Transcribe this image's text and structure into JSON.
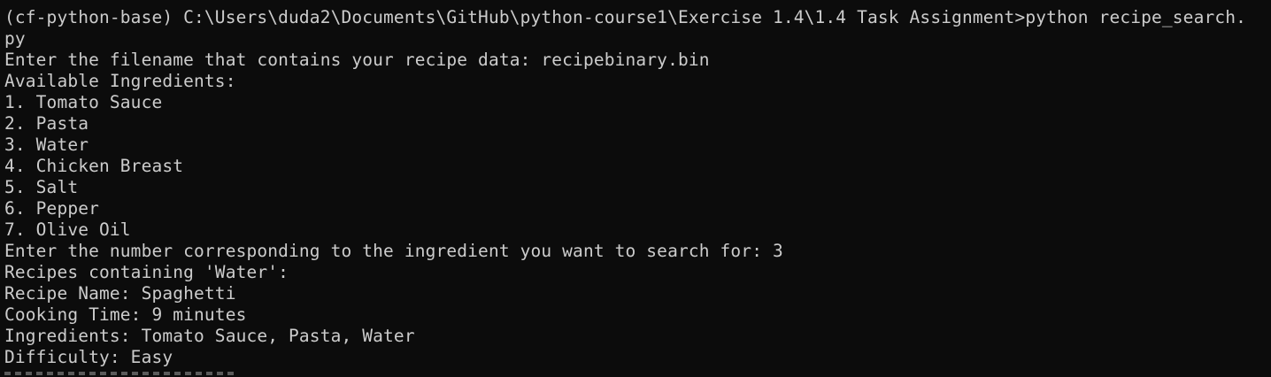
{
  "terminal": {
    "lines": [
      "(cf-python-base) C:\\Users\\duda2\\Documents\\GitHub\\python-course1\\Exercise 1.4\\1.4 Task Assignment>python recipe_search.",
      "py",
      "Enter the filename that contains your recipe data: recipebinary.bin",
      "Available Ingredients:",
      "1. Tomato Sauce",
      "2. Pasta",
      "3. Water",
      "4. Chicken Breast",
      "5. Salt",
      "6. Pepper",
      "7. Olive Oil",
      "Enter the number corresponding to the ingredient you want to search for: 3",
      "Recipes containing 'Water':",
      "Recipe Name: Spaghetti",
      "Cooking Time: 9 minutes",
      "Ingredients: Tomato Sauce, Pasta, Water",
      "Difficulty: Easy"
    ]
  },
  "colors": {
    "background": "#0c0c0c",
    "foreground": "#cccccc"
  }
}
